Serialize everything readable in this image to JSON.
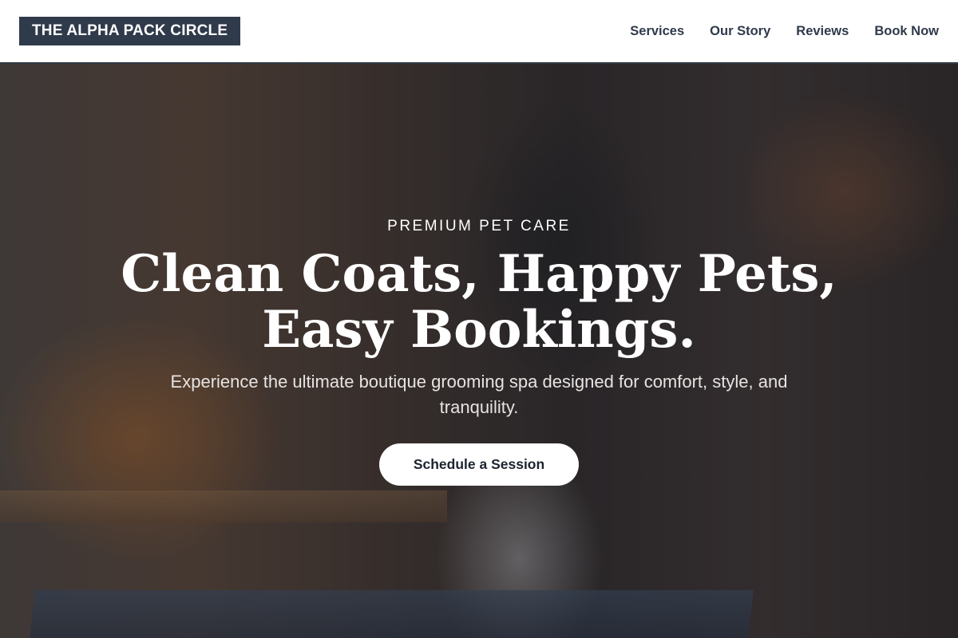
{
  "header": {
    "logo_text": "THE ALPHA PACK CIRCLE",
    "nav": [
      {
        "label": "Services"
      },
      {
        "label": "Our Story"
      },
      {
        "label": "Reviews"
      },
      {
        "label": "Book Now"
      }
    ]
  },
  "hero": {
    "eyebrow": "PREMIUM PET CARE",
    "headline_line1": "Clean Coats, Happy Pets,",
    "headline_line2": "Easy Bookings.",
    "subtext": "Experience the ultimate boutique grooming spa designed for comfort, style, and tranquility.",
    "cta_label": "Schedule a Session",
    "image_subject": "groomer combing a small white dog on a grooming table"
  },
  "colors": {
    "brand_dark": "#2f3a4b",
    "white": "#ffffff",
    "hero_overlay": "rgba(18,18,22,0.42)"
  }
}
